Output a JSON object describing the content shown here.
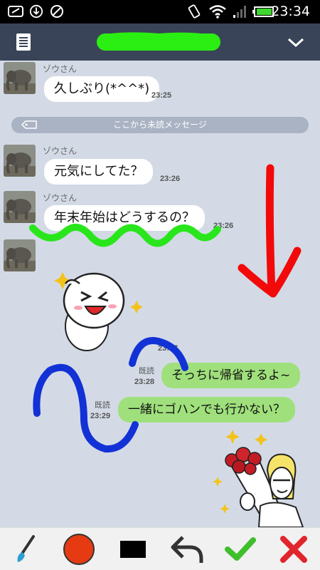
{
  "status_bar": {
    "time": "23:34"
  },
  "chat": {
    "unread_divider": "ここから未読メッセージ",
    "messages": [
      {
        "sender": "ゾウさん",
        "text": "久しぶり(*^^*)",
        "time": "23:25"
      },
      {
        "sender": "ゾウさん",
        "text": "元気にしてた？",
        "time": "23:26"
      },
      {
        "sender": "ゾウさん",
        "text": "年末年始はどうするの？",
        "time": "23:26"
      },
      {
        "sender": "ゾウさん",
        "sticker": "moon-face-sticker",
        "time": "23:27"
      },
      {
        "read": "既読",
        "text": "そっちに帰省するよ~",
        "time": "23:28"
      },
      {
        "read": "既読",
        "text": "一緒にゴハンでも行かない？",
        "time": "23:29"
      }
    ]
  },
  "toolbar": {
    "items": [
      "brush-icon",
      "color-picker",
      "shape-rectangle",
      "undo-icon",
      "confirm-check-icon",
      "cancel-x-icon"
    ],
    "selected_color": "#e63b12"
  },
  "annotations": {
    "colors": {
      "green": "#29e61c",
      "red": "#f20a0a",
      "blue": "#1232d6"
    }
  },
  "colors": {
    "header": "#3a4458",
    "chat_bg": "#d3dae6",
    "outgoing_bubble": "#9fe07c"
  }
}
